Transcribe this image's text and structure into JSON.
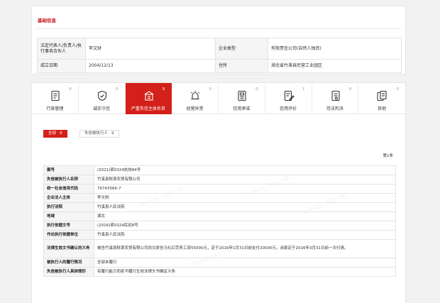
{
  "basic_info": {
    "title": "基础信息",
    "rows": [
      [
        {
          "label": "法定代表人/负责人/执行事务合伙人",
          "value": "李文财"
        },
        {
          "label": "企业类型",
          "value": "有限责任公司(自然人独资)"
        }
      ],
      [
        {
          "label": "成立日期",
          "value": "2004/12/13"
        },
        {
          "label": "住所",
          "value": "湖北省竹溪县民营工业园区"
        }
      ]
    ]
  },
  "tabs": [
    {
      "label": "行政管理",
      "count": "0",
      "icon": "document-icon"
    },
    {
      "label": "诚实守信",
      "count": "0",
      "icon": "shield-check-icon"
    },
    {
      "label": "严重失信主体名单",
      "count": "9",
      "icon": "building-icon",
      "active": true
    },
    {
      "label": "经营异常",
      "count": "0",
      "icon": "alarm-icon"
    },
    {
      "label": "信用承诺",
      "count": "0",
      "icon": "commitment-doc-icon"
    },
    {
      "label": "信用评价",
      "count": "1",
      "icon": "evaluation-icon"
    },
    {
      "label": "司法判决",
      "count": "0",
      "icon": "judgment-doc-icon"
    },
    {
      "label": "其他",
      "count": "0",
      "icon": "other-icon"
    }
  ],
  "filters": {
    "all_label": "全部",
    "all_count": "9",
    "sub_label": "失信被执行人",
    "sub_count": "9"
  },
  "page_indicator": "第1条",
  "record": [
    {
      "label": "案号",
      "value": "(2021)鄂0324执恢84号"
    },
    {
      "label": "失信被执行人名称",
      "value": "竹溪县财源农贸有限公司"
    },
    {
      "label": "统一社会信用代码",
      "value": "76743566-7"
    },
    {
      "label": "企业法人主体",
      "value": "李文财"
    },
    {
      "label": "执行法院",
      "value": "竹溪县人民法院"
    },
    {
      "label": "地域",
      "value": "湖北"
    },
    {
      "label": "执行依据文号",
      "value": "(2016)鄂0324民初8号"
    },
    {
      "label": "作出执行依据单位",
      "value": "竹溪县人民法院"
    },
    {
      "label": "法律生效文书确认的义务",
      "value": "被告竹溪县财源农贸有限公司尚欠原告马礼红劳务工资55000元，定于2016年1月31日前支付20000元，余款定于2016年3月31日前一次付清。",
      "tall": true
    },
    {
      "label": "被执行人的履行情况",
      "value": "全部未履行"
    },
    {
      "label": "失信被执行人具体情形",
      "value": "有履行能力而拒不履行生效法律文书确定义务"
    }
  ],
  "watermark": "信用中国（湖北十堰）"
}
